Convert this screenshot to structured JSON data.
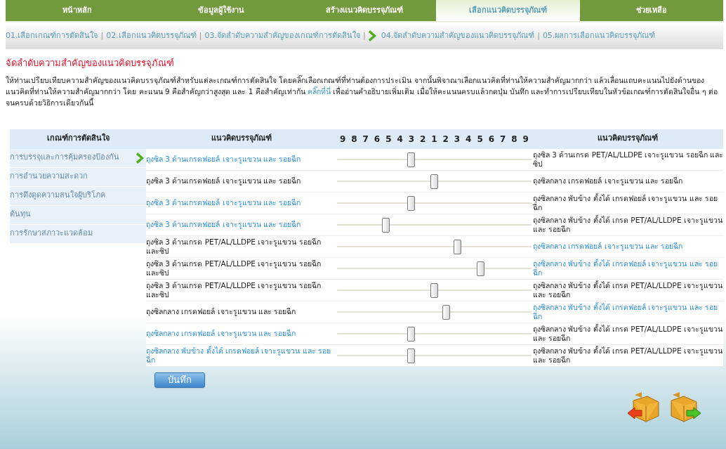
{
  "nav_tabs": [
    {
      "label": "หน้าหลัก",
      "selected": false
    },
    {
      "label": "ข้อมูลผู้ใช้งาน",
      "selected": false
    },
    {
      "label": "สร้างแนวคิดบรรจุภัณฑ์",
      "selected": false
    },
    {
      "label": "เลือกแนวคิดบรรจุภัณฑ์",
      "selected": true
    },
    {
      "label": "ช่วยเหลือ",
      "selected": false
    }
  ],
  "steps": [
    {
      "label": "01.เลือกเกณฑ์การตัดสินใจ",
      "current": false
    },
    {
      "separator": "|",
      "label": "02.เลือกแนวคิดบรรจุภัณฑ์",
      "current": false
    },
    {
      "separator": "|",
      "label": "03.จัดลำดับความสำคัญของเกณฑ์การตัดสินใจ",
      "current": false
    },
    {
      "separator": "|",
      "label": "04.จัดลำดับความสำคัญของแนวคิดบรรจุภัณฑ์",
      "current": true
    },
    {
      "separator": "|",
      "label": "05.ผลการเลือกแนวคิดบรรจุภัณฑ์",
      "current": false
    }
  ],
  "heading": "จัดลำดับความสำคัญของแนวคิดบรรจุภัณฑ์",
  "instructions": {
    "text_before": "ให้ท่านเปรียบเทียบความสำคัญของแนวคิดบรรจุภัณฑ์สำหรับแต่ละเกณฑ์การตัดสินใจ โดยคลิ๊กเลือกเกณฑ์ที่ท่านต้องการประเมิน จากนั้นพิจาณาเลือกแนวคิดที่ท่านให้ความสำคัญมากกว่า แล้วเลื่อนแถบคะแนนไปยังด้านของแนวคิดที่ท่านให้ความสำคัญมากกว่า โดย คะแนน 9 คือสำคัญกว่าสูงสุด และ 1 คือสำคัญเท่ากัน",
    "link": "คลิ๊กที่นี่",
    "text_after": "เพื่ออ่านคำอธิบายเพิ่มเติม เมื่อให้คะแนนครบแล้วกดปุ่ม บันทึก และทำการเปรียบเทียบในหัวข้อเกณฑ์การตัดสินใจอื่น ๆ ต่อจนครบด้วยวิธิการเดียวกันนี้"
  },
  "criteria": {
    "header": "เกณฑ์การตัดสินใจ",
    "items": [
      {
        "label": "การบรรจุและการคุ้มครองป้องกัน",
        "selected": true
      },
      {
        "label": "การอำนวยความสะดวก",
        "selected": false
      },
      {
        "label": "การดึงดูดความสนใจผู้บริโภค",
        "selected": false
      },
      {
        "label": "ต้นทุน",
        "selected": false
      },
      {
        "label": "การรักษาสภาวะแวดล้อม",
        "selected": false
      }
    ]
  },
  "comparison": {
    "left_header": "แนวคิดบรรจุภัณฑ์",
    "scale": [
      "9",
      "8",
      "7",
      "6",
      "5",
      "4",
      "3",
      "2",
      "1",
      "2",
      "3",
      "4",
      "5",
      "6",
      "7",
      "8",
      "9"
    ],
    "right_header": "แนวคิดบรรจุภัณฑ์",
    "rows": [
      {
        "left": {
          "text": "ถุงซิล 3 ด้านเกรดฟอยล์ เจาะรูแขวน และ รอยฉีก",
          "selected": true
        },
        "level": 0.38,
        "right": {
          "text": "ถุงซิล 3 ด้านเกรด PET/AL/LLDPE เจาะรูแขวน รอยฉีก และซิป",
          "selected": false
        }
      },
      {
        "left": {
          "text": "ถุงซิล 3 ด้านเกรดฟอยล์ เจาะรูแขวน และ รอยฉีก",
          "selected": false
        },
        "level": 0.5,
        "right": {
          "text": "ถุงซิลกลาง เกรดฟอยล์ เจาะรูแขวน และ รอยฉีก",
          "selected": false
        }
      },
      {
        "left": {
          "text": "ถุงซิล 3 ด้านเกรดฟอยล์ เจาะรูแขวน และ รอยฉีก",
          "selected": true
        },
        "level": 0.38,
        "right": {
          "text": "ถุงซิลกลาง พับข้าง ตั้งได้ เกรดฟอยล์ เจาะรูแขวน และ รอยฉีก",
          "selected": false
        }
      },
      {
        "left": {
          "text": "ถุงซิล 3 ด้านเกรดฟอยล์ เจาะรูแขวน และ รอยฉีก",
          "selected": true
        },
        "level": 0.25,
        "right": {
          "text": "ถุงซิลกลาง พับข้าง ตั้งได้ เกรด PET/AL/LLDPE เจาะรูแขวน และ รอยฉีก",
          "selected": false
        }
      },
      {
        "left": {
          "text": "ถุงซิล 3 ด้านเกรด PET/AL/LLDPE เจาะรูแขวน รอยฉีก และซิป",
          "selected": false
        },
        "level": 0.62,
        "right": {
          "text": "ถุงซิลกลาง เกรดฟอยล์ เจาะรูแขวน และ รอยฉีก",
          "selected": true
        }
      },
      {
        "left": {
          "text": "ถุงซิล 3 ด้านเกรด PET/AL/LLDPE เจาะรูแขวน รอยฉีก และซิป",
          "selected": false
        },
        "level": 0.74,
        "right": {
          "text": "ถุงซิลกลาง พับข้าง ตั้งได้ เกรดฟอยล์ เจาะรูแขวน และ รอยฉีก",
          "selected": true
        }
      },
      {
        "left": {
          "text": "ถุงซิล 3 ด้านเกรด PET/AL/LLDPE เจาะรูแขวน รอยฉีก และซิป",
          "selected": false
        },
        "level": 0.5,
        "right": {
          "text": "ถุงซิลกลาง พับข้าง ตั้งได้ เกรด PET/AL/LLDPE เจาะรูแขวน และ รอยฉีก",
          "selected": false
        }
      },
      {
        "left": {
          "text": "ถุงซิลกลาง เกรดฟอยล์ เจาะรูแขวน และ รอยฉีก",
          "selected": false
        },
        "level": 0.56,
        "right": {
          "text": "ถุงซิลกลาง พับข้าง ตั้งได้ เกรดฟอยล์ เจาะรูแขวน และ รอยฉีก",
          "selected": true
        }
      },
      {
        "left": {
          "text": "ถุงซิลกลาง เกรดฟอยล์ เจาะรูแขวน และ รอยฉีก",
          "selected": true
        },
        "level": 0.38,
        "right": {
          "text": "ถุงซิลกลาง พับข้าง ตั้งได้ เกรด PET/AL/LLDPE เจาะรูแขวน และ รอยฉีก",
          "selected": false
        }
      },
      {
        "left": {
          "text": "ถุงซิลกลาง พับข้าง ตั้งได้ เกรดฟอยล์ เจาะรูแขวน และ รอยฉีก",
          "selected": true
        },
        "level": 0.38,
        "right": {
          "text": "ถุงซิลกลาง พับข้าง ตั้งได้ เกรด PET/AL/LLDPE เจาะรูแขวน และ รอยฉีก",
          "selected": false
        }
      }
    ]
  },
  "save_button": "บันทึก"
}
